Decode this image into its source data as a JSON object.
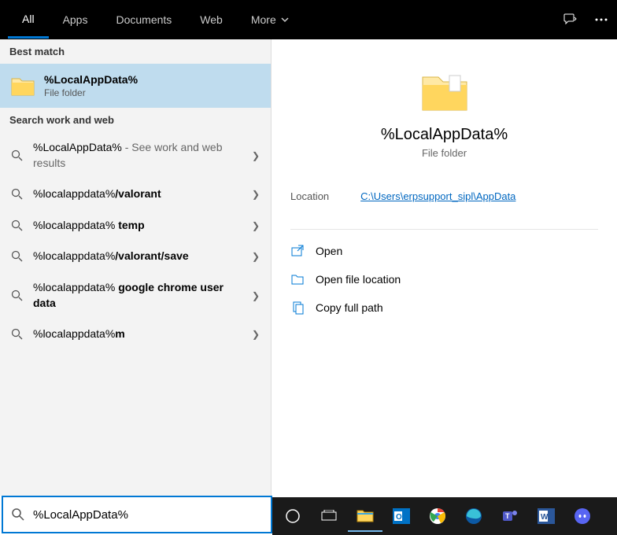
{
  "tabs": [
    "All",
    "Apps",
    "Documents",
    "Web",
    "More"
  ],
  "sections": {
    "best": "Best match",
    "web": "Search work and web"
  },
  "bestMatch": {
    "title": "%LocalAppData%",
    "sub": "File folder"
  },
  "suggestions": [
    {
      "prefix": "%LocalAppData%",
      "rest": " - See work and web results"
    },
    {
      "prefix": "%localappdata%",
      "bold": "/valorant"
    },
    {
      "prefix": "%localappdata% ",
      "bold": "temp"
    },
    {
      "prefix": "%localappdata%",
      "bold": "/valorant/save"
    },
    {
      "prefix": "%localappdata% ",
      "bold": "google chrome user data"
    },
    {
      "prefix": "%localappdata%",
      "bold": "m"
    }
  ],
  "preview": {
    "title": "%LocalAppData%",
    "sub": "File folder",
    "locationLabel": "Location",
    "locationPath": "C:\\Users\\erpsupport_sipl\\AppData"
  },
  "actions": [
    "Open",
    "Open file location",
    "Copy full path"
  ],
  "searchValue": "%LocalAppData%"
}
